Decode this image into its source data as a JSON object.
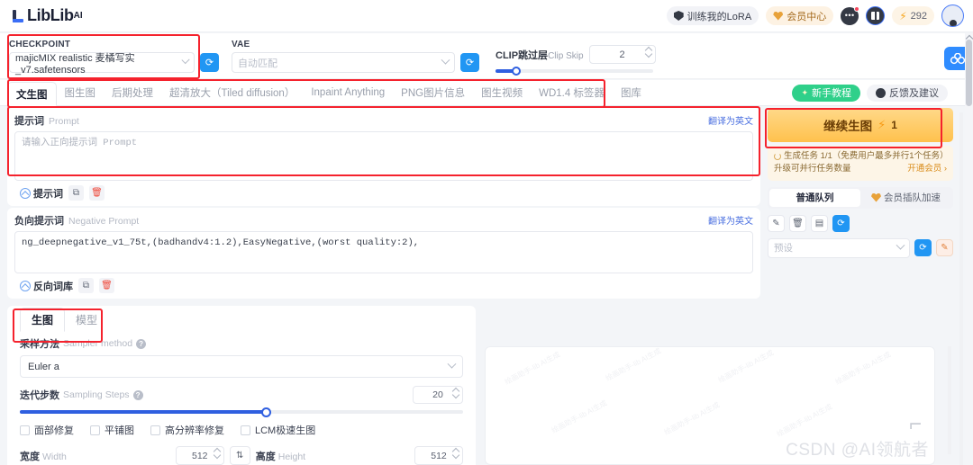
{
  "brand": {
    "name": "LibLib",
    "superscript": "AI"
  },
  "header": {
    "actions": [
      {
        "label": "训练我的LoRA",
        "icon": "shield-icon",
        "style": "plain"
      },
      {
        "label": "会员中心",
        "icon": "heart-icon",
        "style": "gold"
      }
    ],
    "message_icon": "message-bubble-icon",
    "gift_icon": "gift-icon",
    "credits": {
      "icon": "bolt-icon",
      "value": "292"
    },
    "avatar": "user-avatar"
  },
  "model_row": {
    "checkpoint": {
      "label": "CHECKPOINT",
      "value": "majicMIX realistic 麦橘写实_v7.safetensors"
    },
    "vae": {
      "label": "VAE",
      "placeholder": "自动匹配"
    },
    "clip_skip": {
      "label_cn": "CLIP跳过层",
      "label_en": "Clip Skip",
      "value": "2",
      "slider_percent": 12
    },
    "refresh_icon": "refresh-icon"
  },
  "tabs": {
    "items": [
      {
        "label": "文生图",
        "active": true
      },
      {
        "label": "图生图",
        "active": false
      },
      {
        "label": "后期处理",
        "active": false
      },
      {
        "label": "超清放大（Tiled diffusion）",
        "active": false
      },
      {
        "label": "Inpaint Anything",
        "active": false
      },
      {
        "label": "PNG图片信息",
        "active": false
      },
      {
        "label": "图生视频",
        "active": false
      },
      {
        "label": "WD1.4 标签器",
        "active": false
      },
      {
        "label": "图库",
        "active": false
      }
    ],
    "tutorial_button": {
      "label": "新手教程",
      "icon": "sparkle-icon"
    },
    "feedback_button": {
      "label": "反馈及建议",
      "icon": "chat-dot-icon"
    }
  },
  "prompt": {
    "title": "提示词",
    "subtitle": "Prompt",
    "translate": "翻译为英文",
    "placeholder": "请输入正向提示词 Prompt",
    "value": "",
    "library_label": "提示词",
    "copy_icon": "copy-icon",
    "delete_icon": "trash-icon"
  },
  "negative_prompt": {
    "title": "负向提示词",
    "subtitle": "Negative Prompt",
    "translate": "翻译为英文",
    "value": "ng_deepnegative_v1_75t,(badhandv4:1.2),EasyNegative,(worst quality:2),",
    "library_label": "反向词库",
    "copy_icon": "copy-icon",
    "delete_icon": "trash-icon"
  },
  "generate": {
    "button_label": "继续生图",
    "bolt_icon": "bolt-icon",
    "cost": "1",
    "task_line1": "生成任务 1/1（免费用户最多并行1个任务）",
    "task_line2": "升级可并行任务数量",
    "task_upgrade": "开通会员 ›",
    "queue": [
      {
        "label": "普通队列",
        "active": true
      },
      {
        "label": "会员插队加速",
        "active": false,
        "icon": "crown-icon"
      }
    ],
    "mini_buttons": [
      {
        "icon": "wand-icon",
        "label": ""
      },
      {
        "icon": "trash-icon",
        "label": ""
      },
      {
        "icon": "note-icon",
        "label": ""
      },
      {
        "icon": "refresh-icon",
        "label": ""
      }
    ],
    "preset": {
      "placeholder": "预设",
      "save_icon": "refresh-icon",
      "edit_icon": "edit-icon"
    }
  },
  "settings": {
    "subtabs": [
      {
        "label": "生图",
        "active": true
      },
      {
        "label": "模型",
        "active": false
      }
    ],
    "sampler": {
      "label_cn": "采样方法",
      "label_en": "Sampler method",
      "value": "Euler a",
      "help_icon": "help-icon"
    },
    "steps": {
      "label_cn": "迭代步数",
      "label_en": "Sampling Steps",
      "value": "20",
      "help_icon": "help-icon",
      "slider_percent": 56
    },
    "checkboxes": [
      {
        "label": "面部修复",
        "checked": false
      },
      {
        "label": "平铺图",
        "checked": false
      },
      {
        "label": "高分辨率修复",
        "checked": false
      },
      {
        "label": "LCM极速生图",
        "checked": false
      }
    ],
    "width": {
      "label_cn": "宽度",
      "label_en": "Width",
      "value": "512"
    },
    "height": {
      "label_cn": "高度",
      "label_en": "Height",
      "value": "512"
    },
    "swap_icon": "swap-icon"
  },
  "preview": {
    "watermark": "绘画助手-lib AI生成",
    "csdn_watermark": "CSDN @AI领航者"
  },
  "float_button": {
    "icon": "cloud-logo-icon"
  },
  "colors": {
    "accent_blue": "#2f5fe0",
    "generate_gold": "#ffc14d",
    "green": "#2fd08a",
    "annotation_red": "#f5222d"
  }
}
